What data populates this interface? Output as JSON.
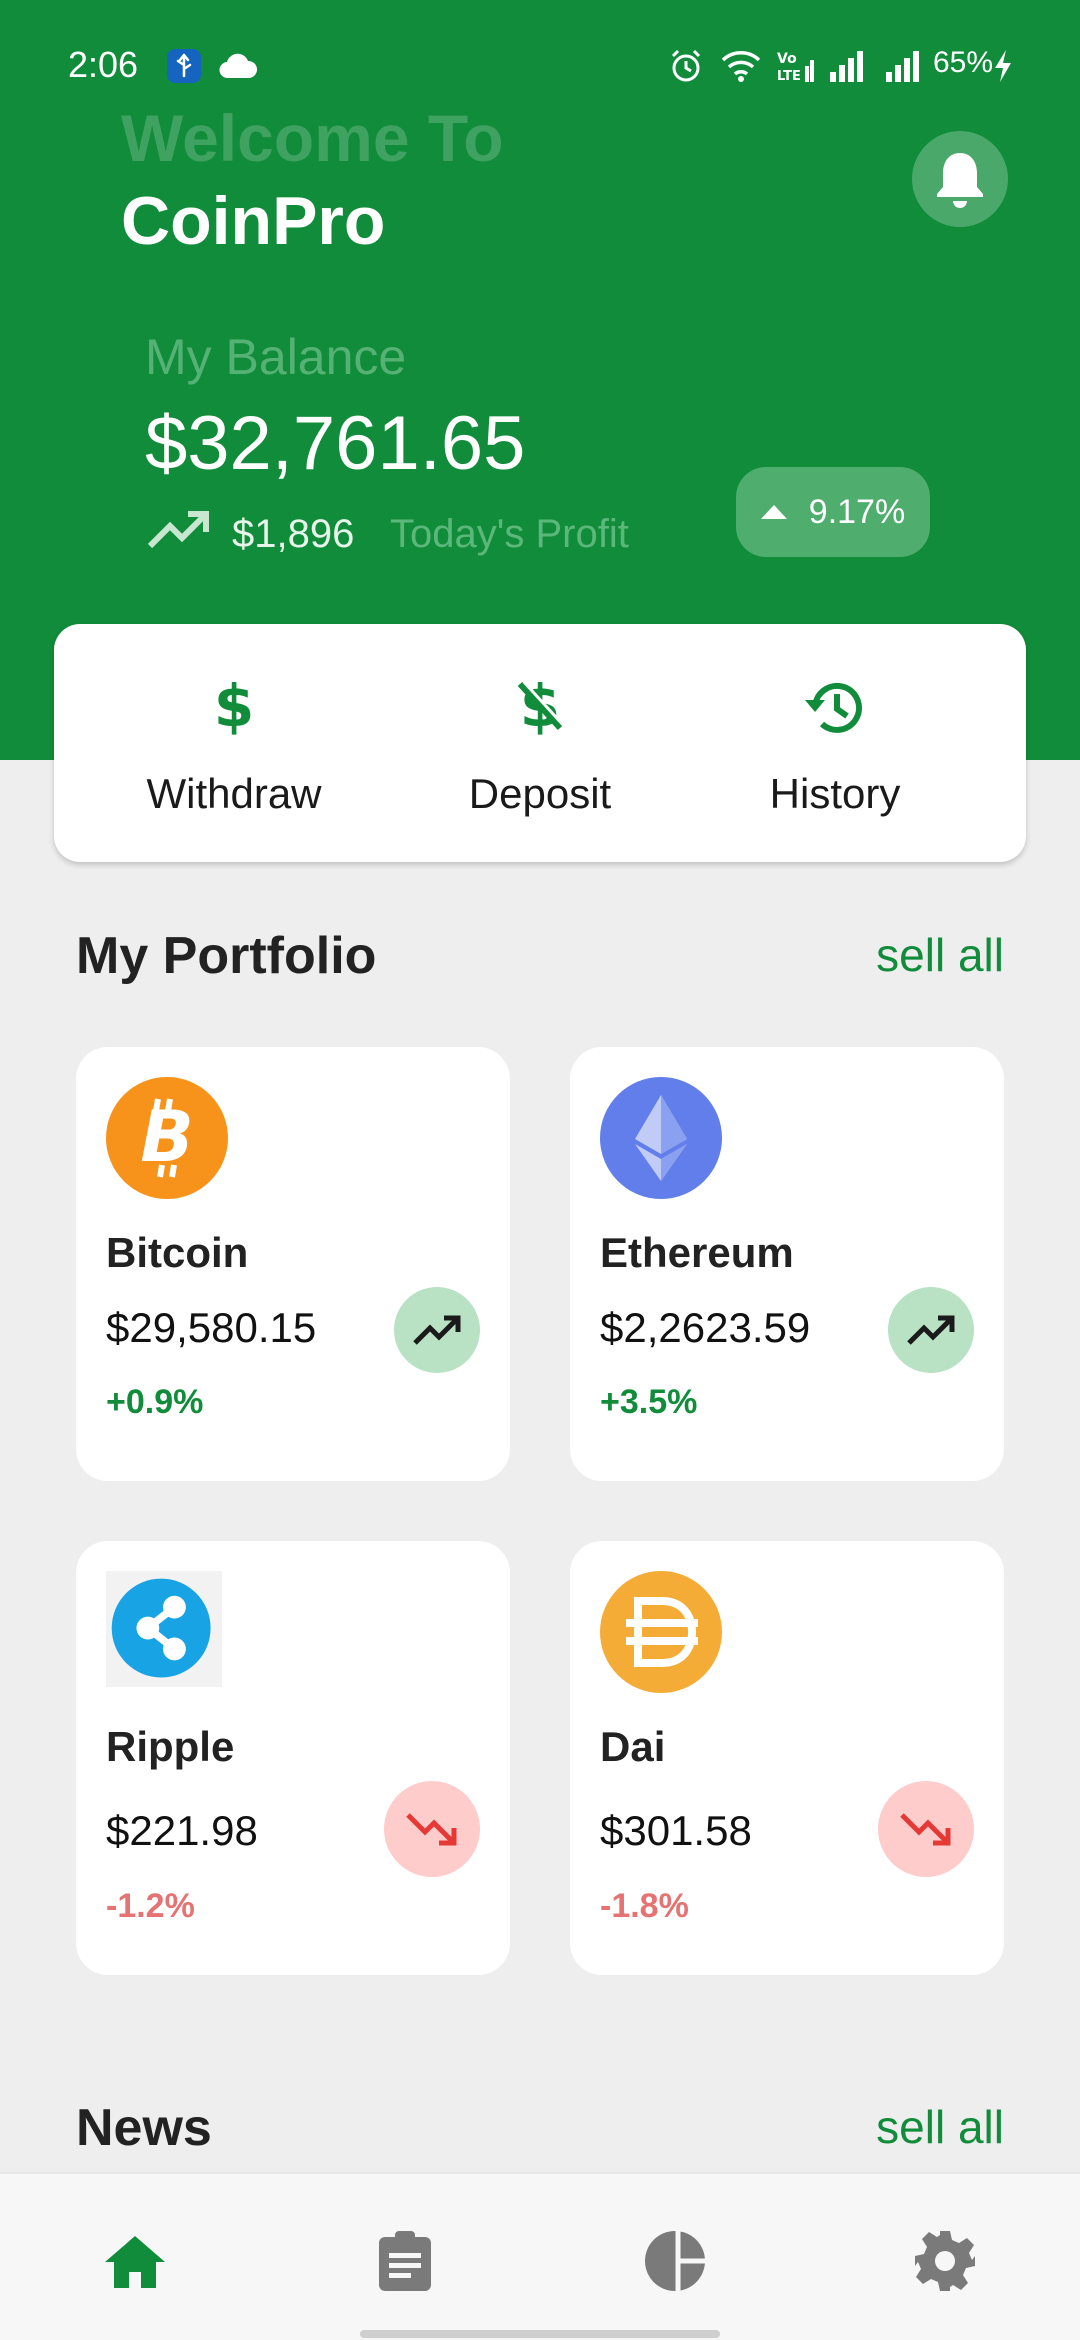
{
  "status_bar": {
    "time": "2:06",
    "battery": "65%"
  },
  "header": {
    "welcome": "Welcome To",
    "app_name": "CoinPro"
  },
  "balance": {
    "label": "My Balance",
    "value": "$32,761.65",
    "profit_amount": "$1,896",
    "profit_label": "Today's Profit",
    "change_percent": "9.17%"
  },
  "actions": [
    {
      "label": "Withdraw",
      "icon": "dollar-icon"
    },
    {
      "label": "Deposit",
      "icon": "dollar-off-icon"
    },
    {
      "label": "History",
      "icon": "history-icon"
    }
  ],
  "portfolio": {
    "title": "My Portfolio",
    "link": "sell all",
    "coins": [
      {
        "name": "Bitcoin",
        "price": "$29,580.15",
        "change": "+0.9%",
        "trend": "up",
        "icon": "bitcoin-logo"
      },
      {
        "name": "Ethereum",
        "price": "$2,2623.59",
        "change": "+3.5%",
        "trend": "up",
        "icon": "ethereum-logo"
      },
      {
        "name": "Ripple",
        "price": "$221.98",
        "change": "-1.2%",
        "trend": "down",
        "icon": "ripple-logo"
      },
      {
        "name": "Dai",
        "price": "$301.58",
        "change": "-1.8%",
        "trend": "down",
        "icon": "dai-logo"
      }
    ]
  },
  "news": {
    "title": "News",
    "link": "sell all"
  },
  "bottom_nav": [
    {
      "icon": "home-icon",
      "active": true
    },
    {
      "icon": "clipboard-icon",
      "active": false
    },
    {
      "icon": "pie-chart-icon",
      "active": false
    },
    {
      "icon": "settings-icon",
      "active": false
    }
  ],
  "colors": {
    "primary": "#118c3a",
    "positive": "#118c3a",
    "negative": "#e57373",
    "up_bg": "#b9e1c4",
    "down_bg": "#ffcccc"
  }
}
